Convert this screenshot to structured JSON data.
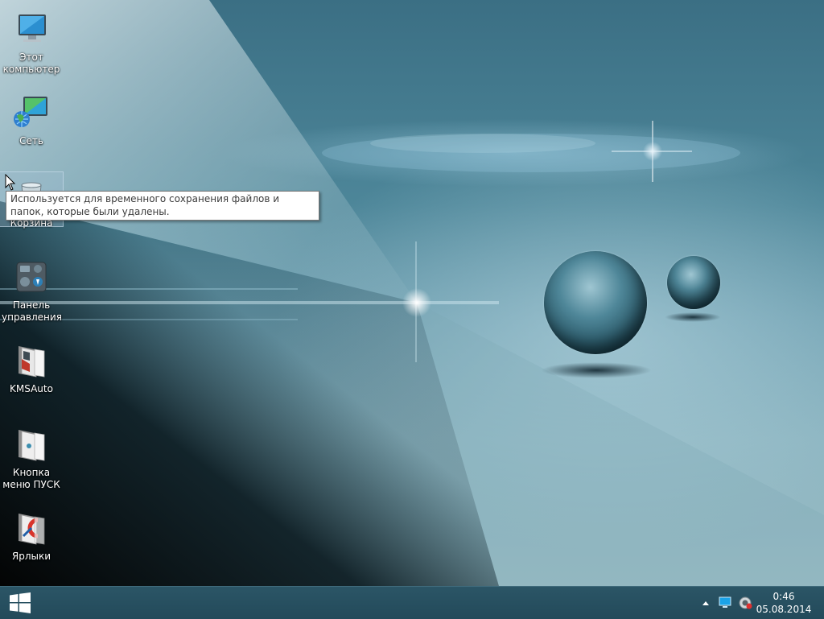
{
  "desktop": {
    "icons": [
      {
        "label": "Этот компьютер",
        "icon": "computer-icon"
      },
      {
        "label": "Сеть",
        "icon": "network-icon"
      },
      {
        "label": "Корзина",
        "icon": "recycle-bin-icon"
      },
      {
        "label": "Панель управления",
        "icon": "control-panel-icon"
      },
      {
        "label": "KMSAuto",
        "icon": "folder-icon"
      },
      {
        "label": "Кнопка меню ПУСК",
        "icon": "folder-icon"
      },
      {
        "label": "Ярлыки",
        "icon": "ccleaner-folder-icon"
      }
    ],
    "tooltip": "Используется для временного сохранения файлов и папок, которые были удалены."
  },
  "taskbar": {
    "start_icon": "windows-logo-icon",
    "tray_icons": [
      "show-hidden-icons-icon",
      "network-icon",
      "volume-icon"
    ],
    "clock": {
      "time": "0:46",
      "date": "05.08.2014"
    }
  }
}
